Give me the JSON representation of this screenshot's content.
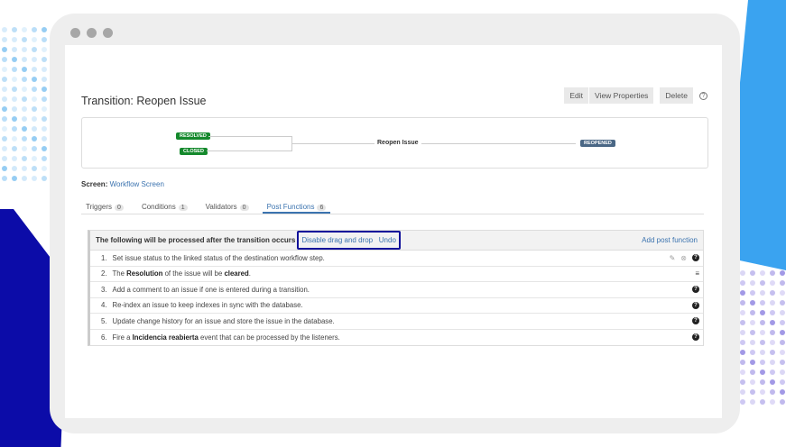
{
  "page": {
    "title": "Transition: Reopen Issue"
  },
  "toolbar": {
    "edit": "Edit",
    "view_properties": "View Properties",
    "delete": "Delete",
    "help": "?"
  },
  "diagram": {
    "from": [
      "RESOLVED",
      "CLOSED"
    ],
    "transition": "Reopen Issue",
    "to": "REOPENED",
    "colors": {
      "done": "#14892c",
      "reopened": "#4a6785"
    }
  },
  "screen": {
    "label": "Screen",
    "value": "Workflow Screen"
  },
  "tabs": [
    {
      "label": "Triggers",
      "count": "0"
    },
    {
      "label": "Conditions",
      "count": "1"
    },
    {
      "label": "Validators",
      "count": "0"
    },
    {
      "label": "Post Functions",
      "count": "6",
      "active": true
    }
  ],
  "post_functions": {
    "header": "The following will be processed after the transition occurs",
    "disable_dnd": "Disable drag and drop",
    "undo": "Undo",
    "add": "Add post function",
    "items": [
      {
        "n": "1.",
        "parts": [
          "Set issue status to the linked status of the destination workflow step."
        ]
      },
      {
        "n": "2.",
        "parts": [
          "The ",
          "Resolution",
          " of the issue will be ",
          "cleared",
          "."
        ]
      },
      {
        "n": "3.",
        "parts": [
          "Add a comment to an issue if one is entered during a transition."
        ]
      },
      {
        "n": "4.",
        "parts": [
          "Re-index an issue to keep indexes in sync with the database."
        ]
      },
      {
        "n": "5.",
        "parts": [
          "Update change history for an issue and store the issue in the database."
        ]
      },
      {
        "n": "6.",
        "parts": [
          "Fire a ",
          "Incidencia reabierta",
          " event that can be processed by the listeners."
        ]
      }
    ]
  },
  "accent": "#3b73af",
  "highlight": "#10109a"
}
